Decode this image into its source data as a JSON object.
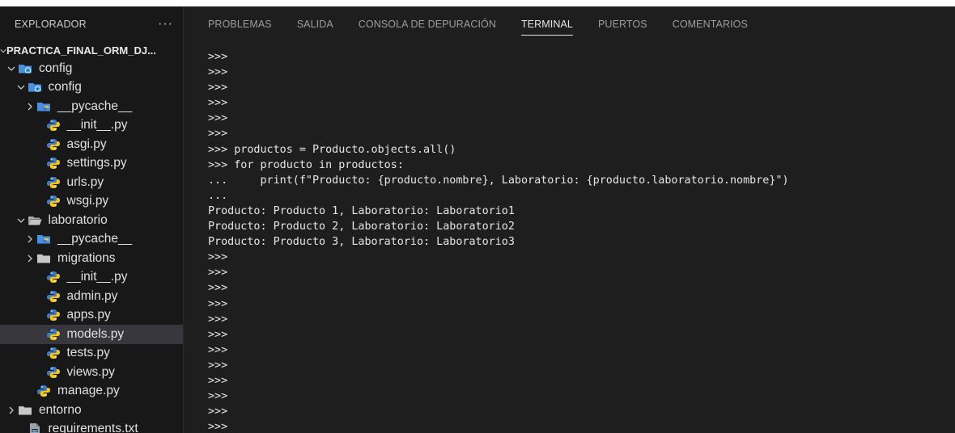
{
  "sidebar": {
    "title": "EXPLORADOR",
    "more": "···",
    "tree": [
      {
        "label": "PRACTICA_FINAL_ORM_DJ...",
        "indent": 0,
        "chevron": "down",
        "icon": "none",
        "kind": "project"
      },
      {
        "label": "config",
        "indent": 1,
        "chevron": "down",
        "icon": "folder-config"
      },
      {
        "label": "config",
        "indent": 2,
        "chevron": "down",
        "icon": "folder-config"
      },
      {
        "label": "__pycache__",
        "indent": 3,
        "chevron": "right",
        "icon": "folder-python"
      },
      {
        "label": "__init__.py",
        "indent": 4,
        "chevron": "none",
        "icon": "python"
      },
      {
        "label": "asgi.py",
        "indent": 4,
        "chevron": "none",
        "icon": "python"
      },
      {
        "label": "settings.py",
        "indent": 4,
        "chevron": "none",
        "icon": "python"
      },
      {
        "label": "urls.py",
        "indent": 4,
        "chevron": "none",
        "icon": "python"
      },
      {
        "label": "wsgi.py",
        "indent": 4,
        "chevron": "none",
        "icon": "python"
      },
      {
        "label": "laboratorio",
        "indent": 2,
        "chevron": "down",
        "icon": "folder-open"
      },
      {
        "label": "__pycache__",
        "indent": 3,
        "chevron": "right",
        "icon": "folder-python"
      },
      {
        "label": "migrations",
        "indent": 3,
        "chevron": "right",
        "icon": "folder"
      },
      {
        "label": "__init__.py",
        "indent": 4,
        "chevron": "none",
        "icon": "python"
      },
      {
        "label": "admin.py",
        "indent": 4,
        "chevron": "none",
        "icon": "python"
      },
      {
        "label": "apps.py",
        "indent": 4,
        "chevron": "none",
        "icon": "python"
      },
      {
        "label": "models.py",
        "indent": 4,
        "chevron": "none",
        "icon": "python",
        "selected": true
      },
      {
        "label": "tests.py",
        "indent": 4,
        "chevron": "none",
        "icon": "python"
      },
      {
        "label": "views.py",
        "indent": 4,
        "chevron": "none",
        "icon": "python"
      },
      {
        "label": "manage.py",
        "indent": 3,
        "chevron": "none",
        "icon": "python"
      },
      {
        "label": "entorno",
        "indent": 1,
        "chevron": "right",
        "icon": "folder"
      },
      {
        "label": "requirements.txt",
        "indent": 2,
        "chevron": "none",
        "icon": "text-file"
      }
    ]
  },
  "panel": {
    "tabs": [
      {
        "label": "PROBLEMAS",
        "active": false
      },
      {
        "label": "SALIDA",
        "active": false
      },
      {
        "label": "CONSOLA DE DEPURACIÓN",
        "active": false
      },
      {
        "label": "TERMINAL",
        "active": true
      },
      {
        "label": "PUERTOS",
        "active": false
      },
      {
        "label": "COMENTARIOS",
        "active": false
      }
    ]
  },
  "terminal": {
    "lines": [
      ">>>",
      ">>>",
      ">>>",
      ">>>",
      ">>>",
      ">>>",
      ">>> productos = Producto.objects.all()",
      ">>> for producto in productos:",
      "...     print(f\"Producto: {producto.nombre}, Laboratorio: {producto.laboratorio.nombre}\")",
      "...",
      "Producto: Producto 1, Laboratorio: Laboratorio1",
      "Producto: Producto 2, Laboratorio: Laboratorio2",
      "Producto: Producto 3, Laboratorio: Laboratorio3",
      ">>>",
      ">>>",
      ">>>",
      ">>>",
      ">>>",
      ">>>",
      ">>>",
      ">>>",
      ">>>",
      ">>>",
      ">>>",
      ">>>",
      ">>>"
    ]
  },
  "colors": {
    "python_blue": "#3d7cc9",
    "python_yellow": "#f5c518",
    "folder_blue": "#4a8fe0",
    "folder_gray": "#c7c7c7",
    "config_gear": "#36a3d9"
  }
}
